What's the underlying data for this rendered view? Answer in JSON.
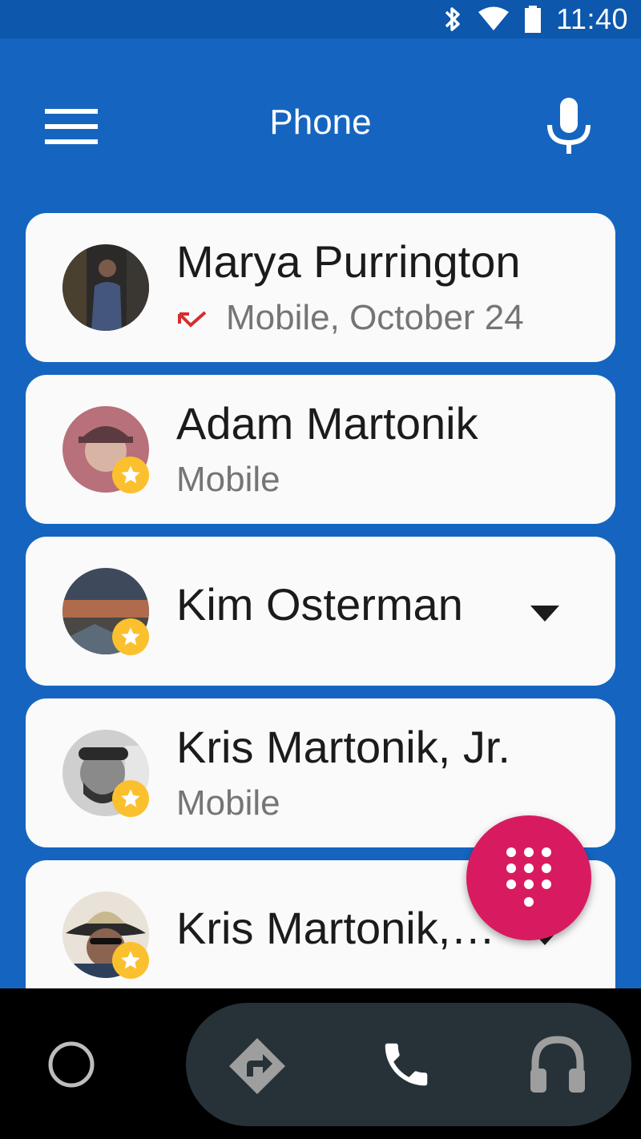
{
  "status_bar": {
    "time": "11:40",
    "icons": [
      "bluetooth-icon",
      "wifi-icon",
      "battery-icon"
    ]
  },
  "app_bar": {
    "title": "Phone",
    "icons": [
      "menu-icon",
      "microphone-icon"
    ]
  },
  "contacts": [
    {
      "name": "Marya Purrington",
      "subtitle": "Mobile, October 24",
      "favorite": false,
      "call_status": "missed",
      "expandable": false
    },
    {
      "name": "Adam Martonik",
      "subtitle": "Mobile",
      "favorite": true,
      "expandable": false
    },
    {
      "name": "Kim Osterman",
      "subtitle": "",
      "favorite": true,
      "expandable": true
    },
    {
      "name": "Kris Martonik, Jr.",
      "subtitle": "Mobile",
      "favorite": true,
      "expandable": false
    },
    {
      "name": "Kris Martonik,…",
      "subtitle": "",
      "favorite": true,
      "expandable": true
    }
  ],
  "fab": {
    "icon": "dialpad-icon"
  },
  "nav_bar": {
    "icons": [
      "home-icon",
      "navigation-icon",
      "phone-icon",
      "headphones-icon"
    ]
  },
  "colors": {
    "primary": "#1565c0",
    "fab": "#d81b60",
    "star": "#fbc02d",
    "missed_call": "#d32f2f"
  }
}
